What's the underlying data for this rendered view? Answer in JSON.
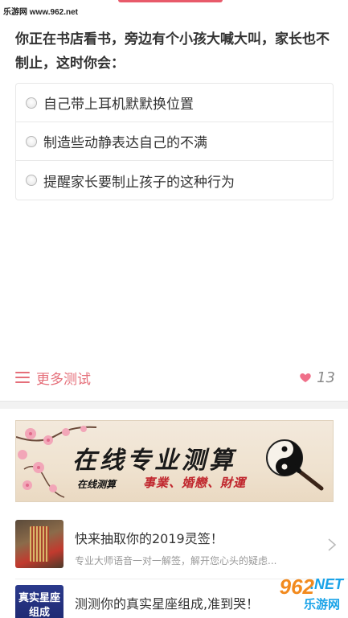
{
  "watermark_top": "乐游网 www.962.net",
  "question": "你正在书店看书，旁边有个小孩大喊大叫，家长也不制止，这时你会：",
  "options": [
    {
      "label": "自己带上耳机默默换位置"
    },
    {
      "label": "制造些动静表达自己的不满"
    },
    {
      "label": "提醒家长要制止孩子的这种行为"
    }
  ],
  "more_tests": {
    "label": "更多测试",
    "icon": "menu-icon"
  },
  "likes": {
    "count": "13",
    "icon": "heart-icon",
    "color": "#f0708a"
  },
  "banner": {
    "title": "在线专业测算",
    "subtitle": "在线测算",
    "tags": "事業、婚戀、財運"
  },
  "list": [
    {
      "title": "快来抽取你的2019灵签！",
      "desc": "专业大师语音一对一解签，解开您心头的疑虑..."
    },
    {
      "title": "测测你的真实星座组成,准到哭！",
      "desc": "",
      "thumb_text": "真实星座组成"
    }
  ],
  "watermark_logo": {
    "num": "962",
    "net": ".NET",
    "cn": "乐游网"
  },
  "colors": {
    "accent": "#e56f7a",
    "divider": "#f2f2f2"
  }
}
